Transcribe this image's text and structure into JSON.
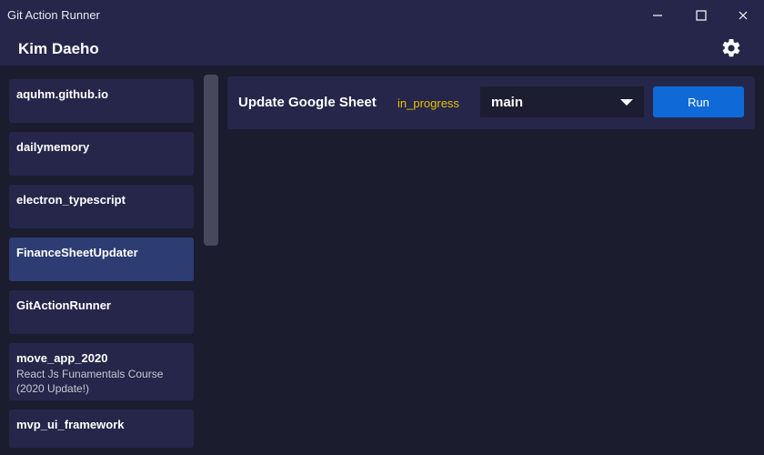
{
  "window": {
    "title": "Git Action Runner"
  },
  "header": {
    "user_name": "Kim Daeho"
  },
  "icons": {
    "minimize": "minimize-icon",
    "maximize": "maximize-icon",
    "close": "close-icon",
    "settings": "gear-icon",
    "dropdown": "chevron-down-icon"
  },
  "repos": [
    {
      "name": "aquhm.github.io",
      "desc": ""
    },
    {
      "name": "dailymemory",
      "desc": ""
    },
    {
      "name": "electron_typescript",
      "desc": ""
    },
    {
      "name": "FinanceSheetUpdater",
      "desc": ""
    },
    {
      "name": "GitActionRunner",
      "desc": ""
    },
    {
      "name": "move_app_2020",
      "desc": "React Js Funamentals Course (2020 Update!)"
    },
    {
      "name": "mvp_ui_framework",
      "desc": ""
    }
  ],
  "selected_repo": "FinanceSheetUpdater",
  "workflow": {
    "name": "Update Google Sheet",
    "status": "in_progress",
    "branch": "main",
    "run_label": "Run"
  },
  "colors": {
    "background": "#1b1c2e",
    "panel": "#25264a",
    "selected": "#2d3d73",
    "status": "#e8c200",
    "accent": "#0f6ad8"
  }
}
